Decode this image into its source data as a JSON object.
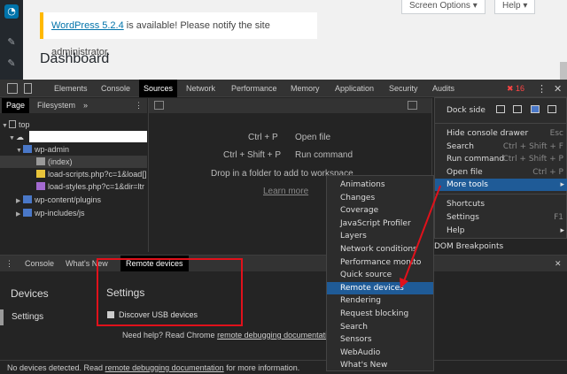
{
  "wordpress": {
    "screen_options": "Screen Options",
    "help": "Help",
    "notice_link": "WordPress 5.2.4",
    "notice_rest": " is available! Please notify the site administrator.",
    "title": "Dashboard"
  },
  "devtools": {
    "tabs": [
      "Elements",
      "Console",
      "Sources",
      "Network",
      "Performance",
      "Memory",
      "Application",
      "Security",
      "Audits"
    ],
    "error_count": "16",
    "sources_subtabs": [
      "Page",
      "Filesystem"
    ],
    "tree": {
      "top": "top",
      "wp_admin": "wp-admin",
      "index": "(index)",
      "load_scripts": "load-scripts.php?c=1&load[]",
      "load_styles": "load-styles.php?c=1&dir=ltr",
      "wp_content": "wp-content/plugins",
      "wp_includes": "wp-includes/js"
    },
    "editor": {
      "shortcut1": "Ctrl + P",
      "action1": "Open file",
      "shortcut2": "Ctrl + Shift + P",
      "action2": "Run command",
      "drop_text": "Drop in a folder to add to workspace",
      "learn_more": "Learn more"
    },
    "drawer_tabs": [
      "Console",
      "What's New",
      "Remote devices"
    ],
    "remote": {
      "devices_heading": "Devices",
      "settings_side": "Settings",
      "settings_heading": "Settings",
      "usb_label": "Discover USB devices",
      "help_prefix": "Need help? Read Chrome ",
      "help_link": "remote debugging documentation"
    },
    "status": {
      "prefix": "No devices detected. Read ",
      "link": "remote debugging documentation",
      "suffix": " for more information."
    }
  },
  "menu": {
    "dock_side": "Dock side",
    "items": [
      {
        "label": "Hide console drawer",
        "shortcut": "Esc"
      },
      {
        "label": "Search",
        "shortcut": "Ctrl + Shift + F"
      },
      {
        "label": "Run command",
        "shortcut": "Ctrl + Shift + P"
      },
      {
        "label": "Open file",
        "shortcut": "Ctrl + P"
      },
      {
        "label": "More tools",
        "shortcut": "▸"
      }
    ],
    "items2": [
      {
        "label": "Shortcuts",
        "shortcut": ""
      },
      {
        "label": "Settings",
        "shortcut": "F1"
      },
      {
        "label": "Help",
        "shortcut": "▸"
      }
    ],
    "dom_breakpoints": "DOM Breakpoints"
  },
  "submenu": {
    "items": [
      "Animations",
      "Changes",
      "Coverage",
      "JavaScript Profiler",
      "Layers",
      "Network conditions",
      "Performance monito",
      "Quick source",
      "Remote devices",
      "Rendering",
      "Request blocking",
      "Search",
      "Sensors",
      "WebAudio",
      "What's New"
    ],
    "highlighted": "Remote devices"
  },
  "colors": {
    "highlight": "#1f5b97",
    "annotation_red": "#e0111b",
    "wp_blue": "#0073aa",
    "notice_yellow": "#ffb900"
  }
}
